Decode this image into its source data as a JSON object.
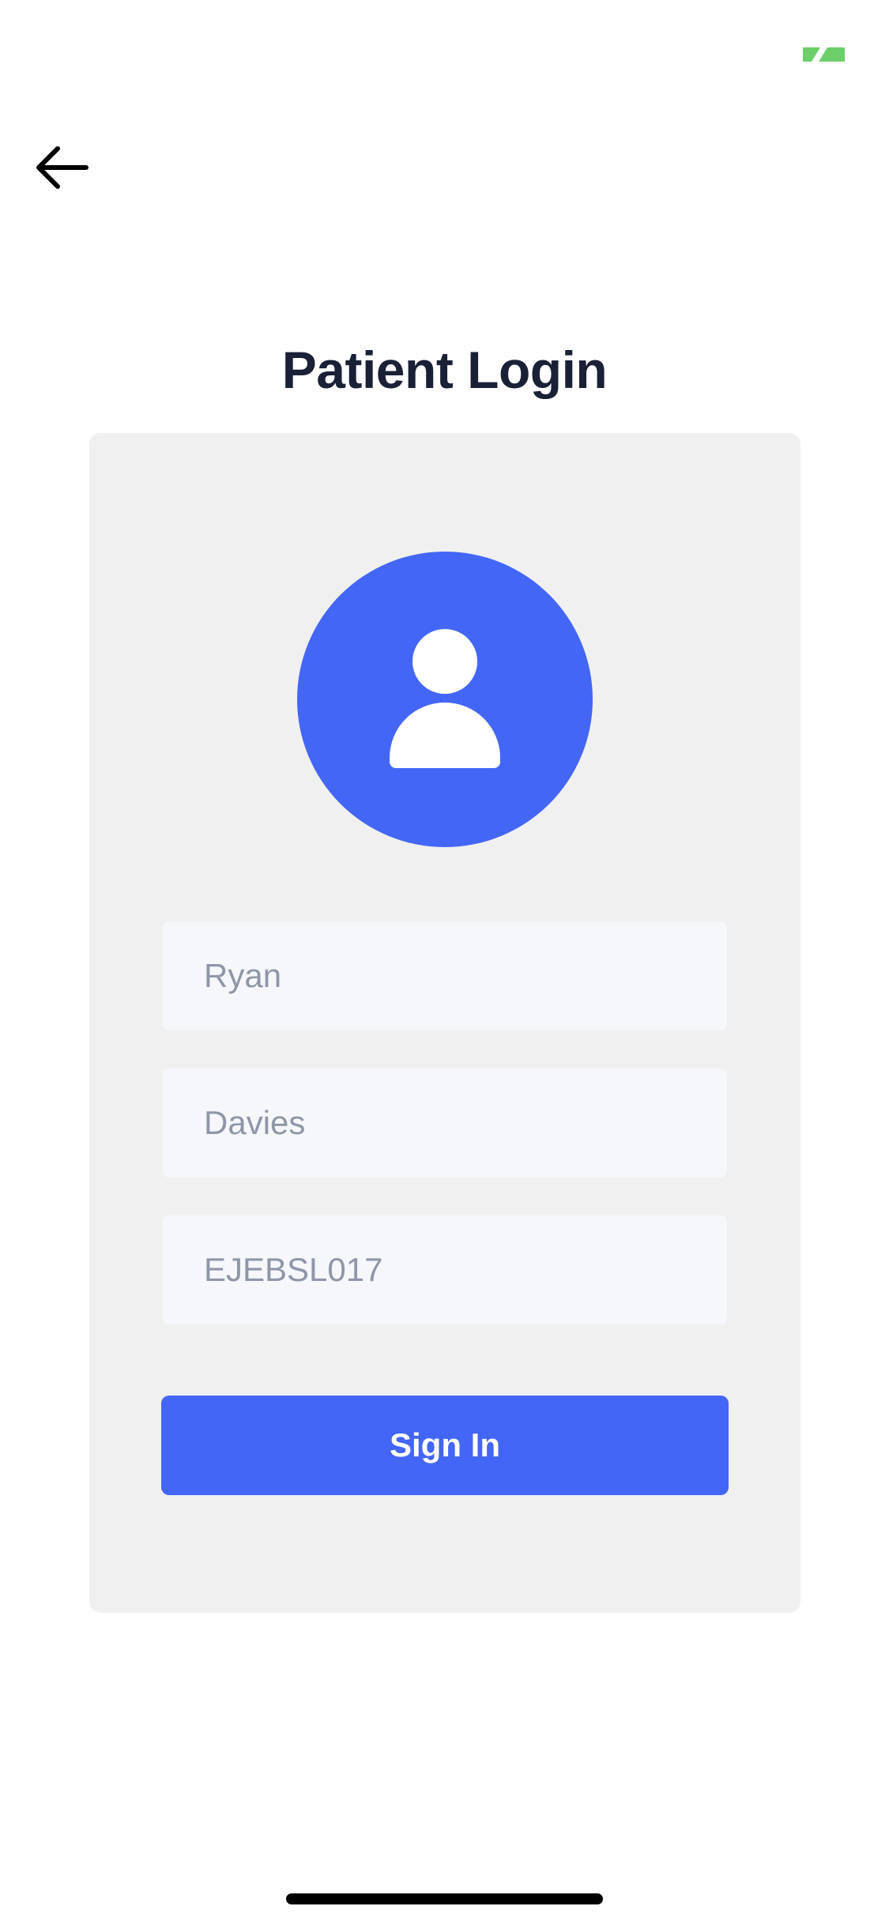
{
  "status_bar": {
    "indicator_icon": "battery-charging-icon",
    "indicator_color": "#6ccf6a"
  },
  "header": {
    "back_icon": "arrow-left-icon"
  },
  "page": {
    "title": "Patient Login"
  },
  "form": {
    "avatar_icon": "user-icon",
    "first_name": {
      "value": "",
      "placeholder": "Ryan"
    },
    "last_name": {
      "value": "",
      "placeholder": "Davies"
    },
    "patient_id": {
      "value": "",
      "placeholder": "EJEBSL017"
    },
    "submit_label": "Sign In"
  },
  "colors": {
    "accent": "#4366f6",
    "title": "#1a2036",
    "card_background": "#f0f0f0",
    "field_background": "#f6f7fb",
    "placeholder_text": "#8f96a8"
  }
}
